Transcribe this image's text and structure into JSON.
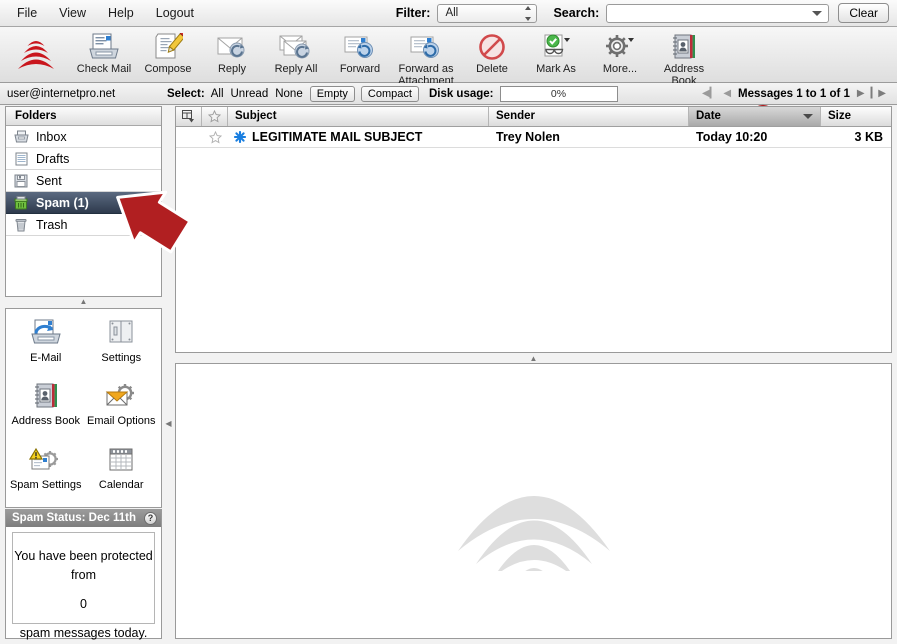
{
  "menubar": {
    "items": [
      {
        "label": "File",
        "name": "menu-file"
      },
      {
        "label": "View",
        "name": "menu-view"
      },
      {
        "label": "Help",
        "name": "menu-help"
      },
      {
        "label": "Logout",
        "name": "menu-logout"
      }
    ],
    "filter_label": "Filter:",
    "filter_value": "All",
    "search_label": "Search:",
    "search_value": "",
    "search_placeholder": "",
    "clear_label": "Clear"
  },
  "toolbar": {
    "buttons": [
      {
        "label": "Check Mail",
        "icon": "check-mail-icon"
      },
      {
        "label": "Compose",
        "icon": "compose-icon"
      },
      {
        "label": "Reply",
        "icon": "reply-icon"
      },
      {
        "label": "Reply All",
        "icon": "reply-all-icon"
      },
      {
        "label": "Forward",
        "icon": "forward-icon"
      },
      {
        "label": "Forward as Attachment",
        "icon": "forward-as-attachment-icon"
      },
      {
        "label": "Delete",
        "icon": "delete-icon"
      },
      {
        "label": "Mark As",
        "icon": "mark-as-icon"
      },
      {
        "label": "More...",
        "icon": "more-icon"
      },
      {
        "label": "Address Book",
        "icon": "address-book-icon"
      }
    ]
  },
  "infobar": {
    "account": "user@internetpro.net",
    "select_label": "Select:",
    "select_all": "All",
    "select_unread": "Unread",
    "select_none": "None",
    "empty_label": "Empty",
    "compact_label": "Compact",
    "disk_label": "Disk usage:",
    "disk_value": "0%",
    "pager_text": "Messages 1 to 1 of 1"
  },
  "folders": {
    "header": "Folders",
    "items": [
      {
        "label": "Inbox",
        "icon": "inbox-icon",
        "selected": false
      },
      {
        "label": "Drafts",
        "icon": "drafts-icon",
        "selected": false
      },
      {
        "label": "Sent",
        "icon": "sent-icon",
        "selected": false
      },
      {
        "label": "Spam (1)",
        "icon": "spam-icon",
        "selected": true
      },
      {
        "label": "Trash",
        "icon": "trash-icon",
        "selected": false
      }
    ]
  },
  "shortcuts": {
    "items": [
      {
        "label": "E-Mail",
        "icon": "email-icon"
      },
      {
        "label": "Settings",
        "icon": "settings-icon"
      },
      {
        "label": "Address Book",
        "icon": "address-book-icon"
      },
      {
        "label": "Email Options",
        "icon": "email-options-icon"
      },
      {
        "label": "Spam Settings",
        "icon": "spam-settings-icon"
      },
      {
        "label": "Calendar",
        "icon": "calendar-icon"
      }
    ]
  },
  "spam_status": {
    "header": "Spam Status: Dec 11th",
    "help_glyph": "?",
    "line1": "You have been protected from",
    "count": "0",
    "line2": "spam messages today."
  },
  "message_list": {
    "columns": [
      "Subject",
      "Sender",
      "Date",
      "Size"
    ],
    "sort_column": "Date",
    "rows": [
      {
        "subject": "LEGITIMATE MAIL SUBJECT",
        "sender": "Trey Nolen",
        "date": "Today 10:20",
        "size": "3 KB",
        "unread": true,
        "flagged": false
      }
    ]
  },
  "preview": {
    "watermark": "signal-arcs-watermark"
  },
  "colors": {
    "accent_red": "#c9161d",
    "selected_folder": "#2e3a4d",
    "unread_dot": "#1a7fe0",
    "annotation_red": "#b11f21"
  }
}
